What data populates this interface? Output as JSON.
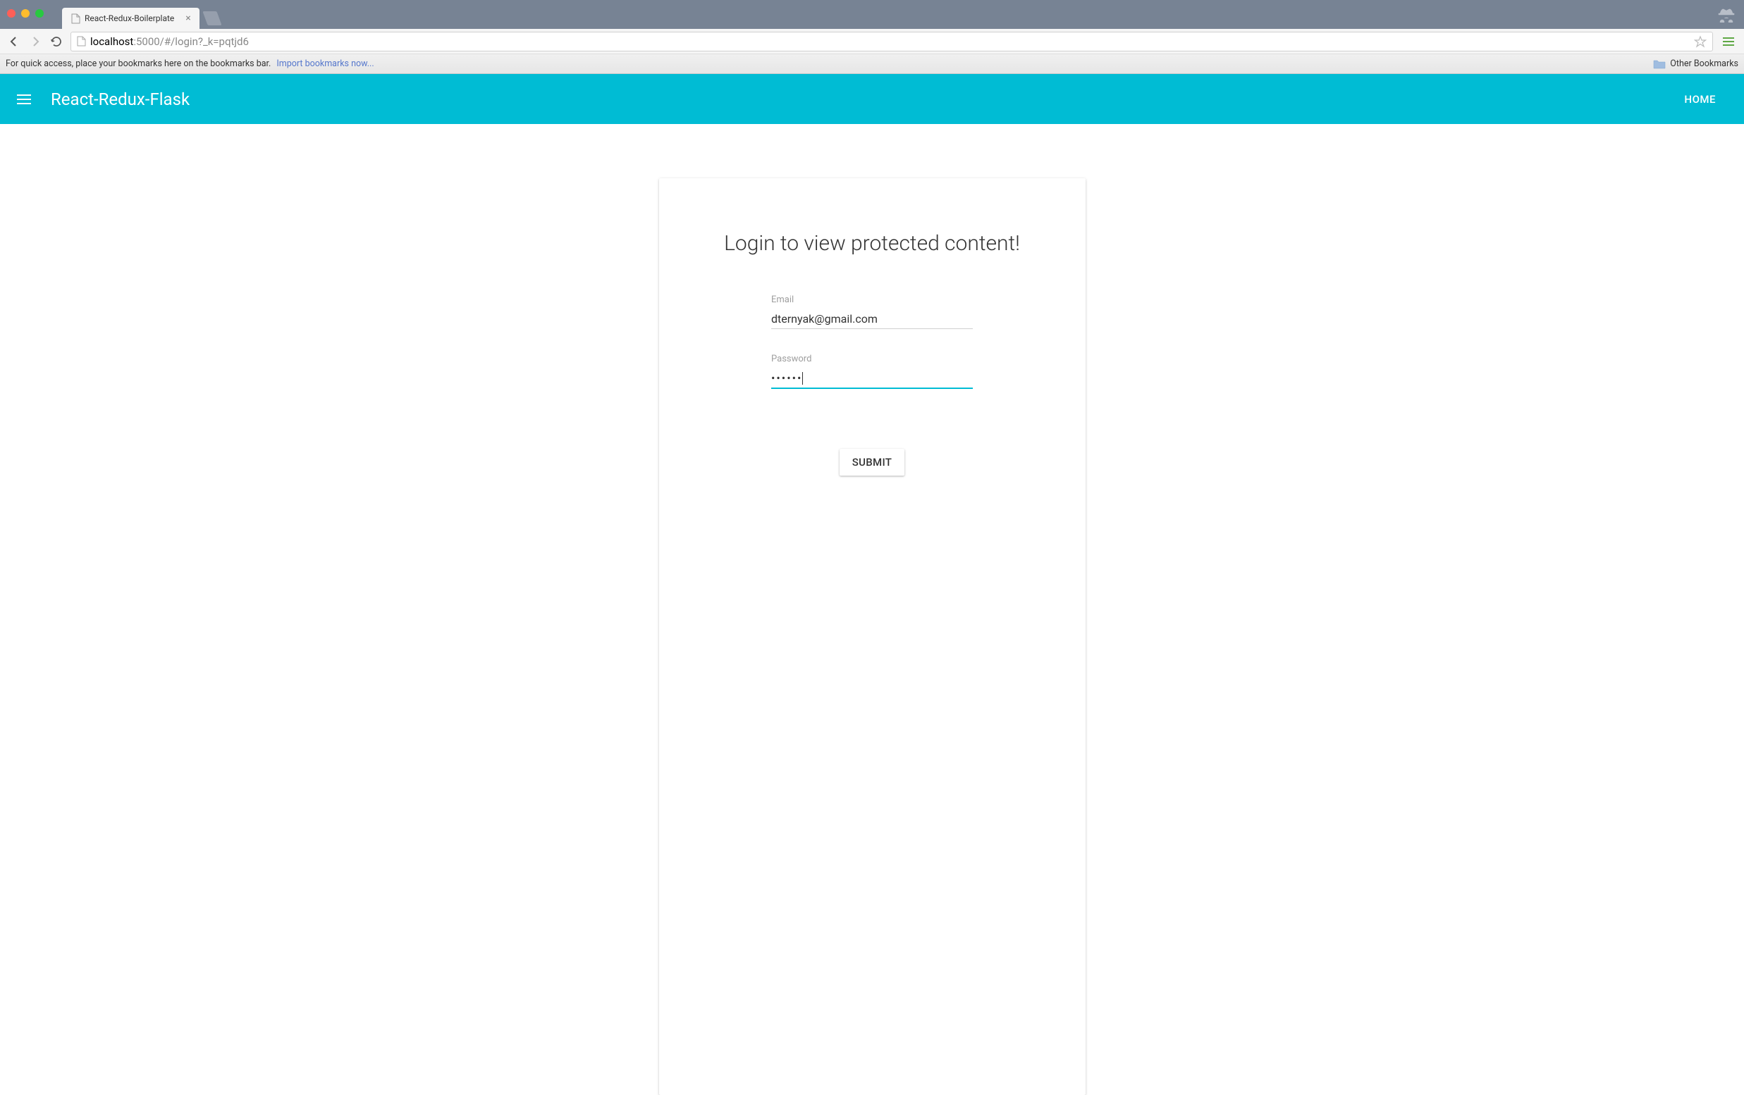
{
  "browser": {
    "tab_title": "React-Redux-Boilerplate",
    "url_host": "localhost",
    "url_port_path": ":5000/#/login?_k=pqtjd6"
  },
  "bookmarks_bar": {
    "hint_text": "For quick access, place your bookmarks here on the bookmarks bar.",
    "import_link": "Import bookmarks now...",
    "other_bookmarks": "Other Bookmarks"
  },
  "app_bar": {
    "title": "React-Redux-Flask",
    "home_link": "HOME"
  },
  "login": {
    "heading": "Login to view protected content!",
    "email_label": "Email",
    "email_value": "dternyak@gmail.com",
    "password_label": "Password",
    "password_value": "••••••",
    "submit_label": "SUBMIT"
  }
}
